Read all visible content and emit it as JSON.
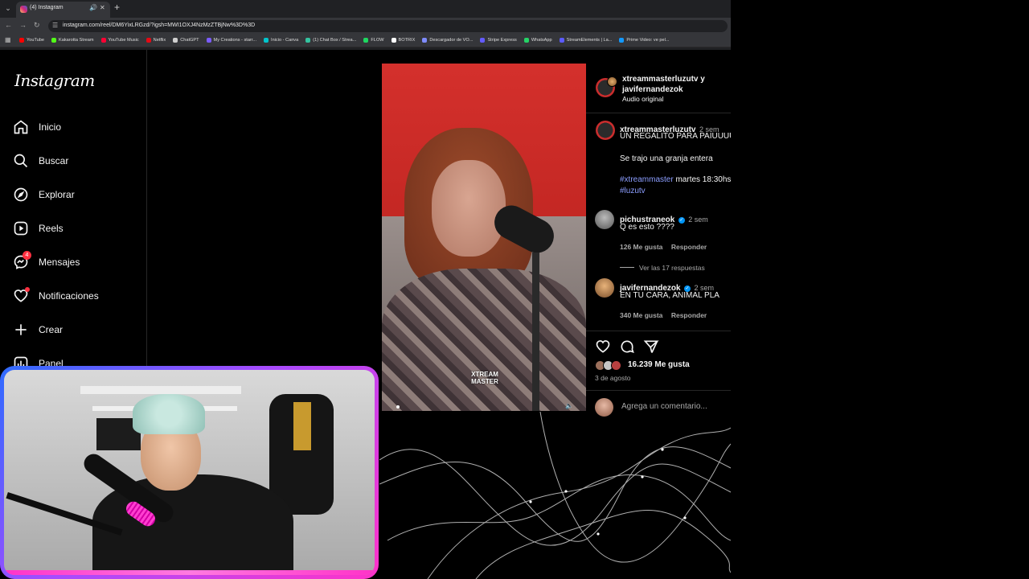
{
  "browser": {
    "tab_title": "(4) Instagram",
    "tab_audio_icon": "speaker-icon",
    "tab_close_icon": "close-icon",
    "new_tab_icon": "plus-icon",
    "url": "instagram.com/reel/DM6YixLRGzd/?igsh=MWI1OXJ4NzMzZTBjNw%3D%3D",
    "bookmarks": [
      {
        "label": "YouTube",
        "color": "#ff0000"
      },
      {
        "label": "Kakarotta Stream",
        "color": "#53fc18"
      },
      {
        "label": "YouTube Music",
        "color": "#ff0033"
      },
      {
        "label": "Netflix",
        "color": "#e50914"
      },
      {
        "label": "ChatGPT",
        "color": "#cfcfcf"
      },
      {
        "label": "My Creations - starr...",
        "color": "#7b5cff"
      },
      {
        "label": "Inicio - Canva",
        "color": "#00c4cc"
      },
      {
        "label": "(1) Chat Box / Strea...",
        "color": "#34c3a0"
      },
      {
        "label": "FLOW",
        "color": "#1ed760"
      },
      {
        "label": "BOTRIX",
        "color": "#ffffff"
      },
      {
        "label": "Descargador de VO...",
        "color": "#7f8cff"
      },
      {
        "label": "Stripe Express",
        "color": "#635bff"
      },
      {
        "label": "WhatsApp",
        "color": "#25d366"
      },
      {
        "label": "StreamElements | La...",
        "color": "#5b5bff"
      },
      {
        "label": "Prime Video: ve pel...",
        "color": "#1399ff"
      }
    ]
  },
  "sidebar": {
    "logo": "Instagram",
    "items": [
      {
        "label": "Inicio",
        "icon": "home-icon"
      },
      {
        "label": "Buscar",
        "icon": "search-icon"
      },
      {
        "label": "Explorar",
        "icon": "compass-icon"
      },
      {
        "label": "Reels",
        "icon": "reels-icon"
      },
      {
        "label": "Mensajes",
        "icon": "messenger-icon",
        "badge": "4"
      },
      {
        "label": "Notificaciones",
        "icon": "heart-icon"
      },
      {
        "label": "Crear",
        "icon": "plus-icon"
      },
      {
        "label": "Panel",
        "icon": "dashboard-icon"
      }
    ]
  },
  "reel": {
    "brand_line1": "XTREAM",
    "brand_line2": "MASTER",
    "volume_icon": "volume-icon"
  },
  "panel": {
    "header_user_line1": "xtreammasterluzutv y",
    "header_user_line2": "javifernandezok",
    "header_audio": "Audio original",
    "caption": {
      "user": "xtreammasterluzutv",
      "time": "2 sem",
      "line1": "UN REGALITO PARA PAIUUUU",
      "line2": "Se trajo una granja entera",
      "hashtag1": "#xtreammaster",
      "line3_rest": " martes 18:30hs",
      "hashtag2": "#luzutv"
    },
    "comments": [
      {
        "user": "pichustraneok",
        "time": "2 sem",
        "text": "Q es esto ????",
        "likes": "126 Me gusta",
        "reply": "Responder",
        "view_replies": "Ver las 17 respuestas"
      },
      {
        "user": "javifernandezok",
        "time": "2 sem",
        "text": "EN TU CARA, ANIMAL PLA",
        "likes": "340 Me gusta",
        "reply": "Responder"
      }
    ],
    "likes_count": "16.239 Me gusta",
    "date": "3 de agosto",
    "comment_placeholder": "Agrega un comentario..."
  },
  "colors": {
    "accent_blue": "#0095f6",
    "badge_red": "#ff3040",
    "hashtag": "#8c9eff",
    "webcam_border_start": "#2e6bff",
    "webcam_border_end": "#ff33c8"
  }
}
